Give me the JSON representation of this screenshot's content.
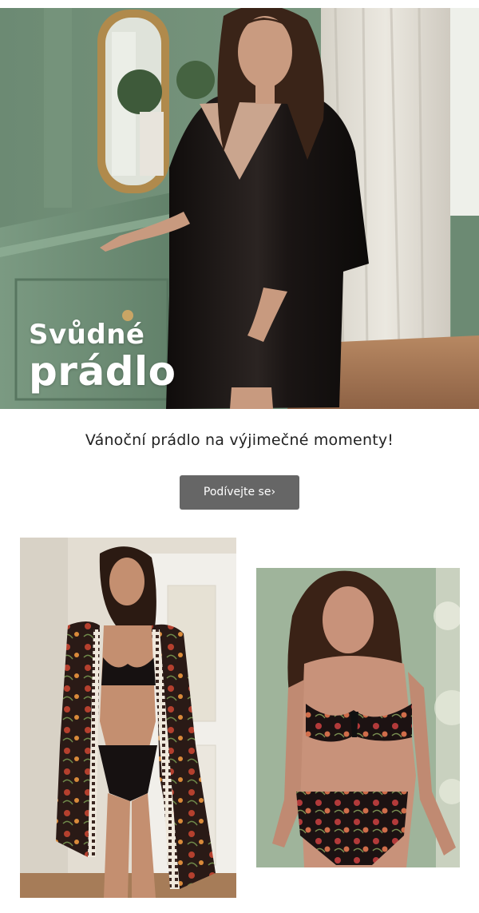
{
  "hero": {
    "title_line1": "Svůdné",
    "title_line2": "prádlo"
  },
  "tagline": "Vánoční prádlo na výjimečné momenty!",
  "cta": {
    "label": "Podívejte se",
    "arrow": "›"
  },
  "colors": {
    "wall_green": "#6f8f77",
    "button_gray": "#666666",
    "satin_black": "#1b1716"
  }
}
